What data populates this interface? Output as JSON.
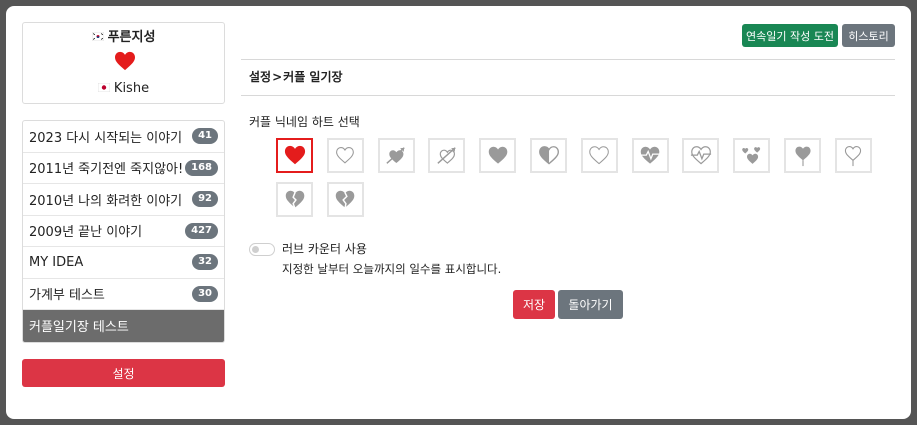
{
  "couple": {
    "name_top": "푸른지성",
    "name_bottom": "Kishe"
  },
  "diaries": [
    {
      "label": "2023 다시 시작되는 이야기",
      "count": "41"
    },
    {
      "label": "2011년 죽기전엔 죽지않아!",
      "count": "168"
    },
    {
      "label": "2010년 나의 화려한 이야기",
      "count": "92"
    },
    {
      "label": "2009년 끝난 이야기",
      "count": "427"
    },
    {
      "label": "MY IDEA",
      "count": "32"
    },
    {
      "label": "가계부 테스트",
      "count": "30"
    },
    {
      "label": "커플일기장 테스트",
      "count": ""
    }
  ],
  "sidebar": {
    "settings_label": "설정"
  },
  "header": {
    "challenge_label": "연속일기 작성 도전",
    "history_label": "히스토리"
  },
  "breadcrumb": {
    "root": "설정",
    "separator": ">",
    "current": "커플 일기장"
  },
  "heart_section": {
    "label": "커플 닉네임 하트 선택",
    "icons": [
      "heart-solid-icon",
      "heart-outline-icon",
      "heart-arrow-solid-icon",
      "heart-arrow-outline-icon",
      "heart-solid-gray-icon",
      "heart-half-icon",
      "heart-thin-outline-icon",
      "heart-pulse-solid-icon",
      "heart-pulse-outline-icon",
      "hearts-cluster-icon",
      "heart-balloon-solid-icon",
      "heart-balloon-outline-icon",
      "heart-broken-icon",
      "heart-broken-alt-icon"
    ],
    "selected_index": 0
  },
  "love_counter": {
    "label": "러브 카운터 사용",
    "description": "지정한 날부터 오늘까지의 일수를 표시합니다.",
    "enabled": false
  },
  "actions": {
    "save_label": "저장",
    "back_label": "돌아가기"
  },
  "colors": {
    "accent_red": "#dc3545",
    "heart_red": "#e41c1c",
    "green": "#198754",
    "gray": "#6c757d",
    "icon_gray": "#9a9a9a"
  }
}
